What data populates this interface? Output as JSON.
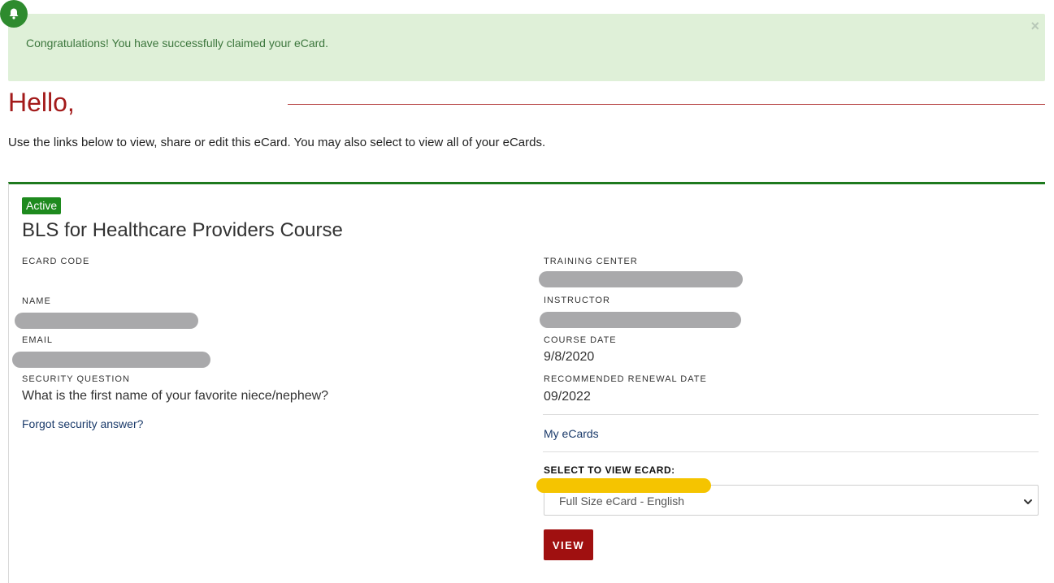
{
  "alert": {
    "message": "Congratulations! You have successfully claimed your eCard.",
    "close_glyph": "×",
    "icon": "bell-icon"
  },
  "greeting": "Hello,",
  "intro": "Use the links below to view, share or edit this eCard. You may also select to view all of your eCards.",
  "card": {
    "status": "Active",
    "course_title": "BLS for Healthcare Providers Course",
    "left": {
      "ecard_code_label": "ECARD CODE",
      "name_label": "NAME",
      "email_label": "EMAIL",
      "security_question_label": "SECURITY QUESTION",
      "security_question": "What is the first name of your favorite niece/nephew?",
      "forgot_link": "Forgot security answer?"
    },
    "right": {
      "training_center_label": "TRAINING CENTER",
      "instructor_label": "INSTRUCTOR",
      "course_date_label": "COURSE DATE",
      "course_date": "9/8/2020",
      "renewal_label": "RECOMMENDED RENEWAL DATE",
      "renewal_date": "09/2022",
      "my_ecards_link": "My eCards",
      "select_label": "SELECT TO VIEW ECARD:",
      "select_value": "Full Size eCard - English",
      "view_button": "VIEW"
    }
  },
  "colors": {
    "alert_bg": "#dff0d8",
    "alert_text": "#3c763d",
    "greeting": "#a31a1a",
    "card_border": "#1e7a1e",
    "badge": "#1e8a1e",
    "button": "#a01010",
    "redaction": "#a9a9ab",
    "highlight": "#f5c400"
  }
}
